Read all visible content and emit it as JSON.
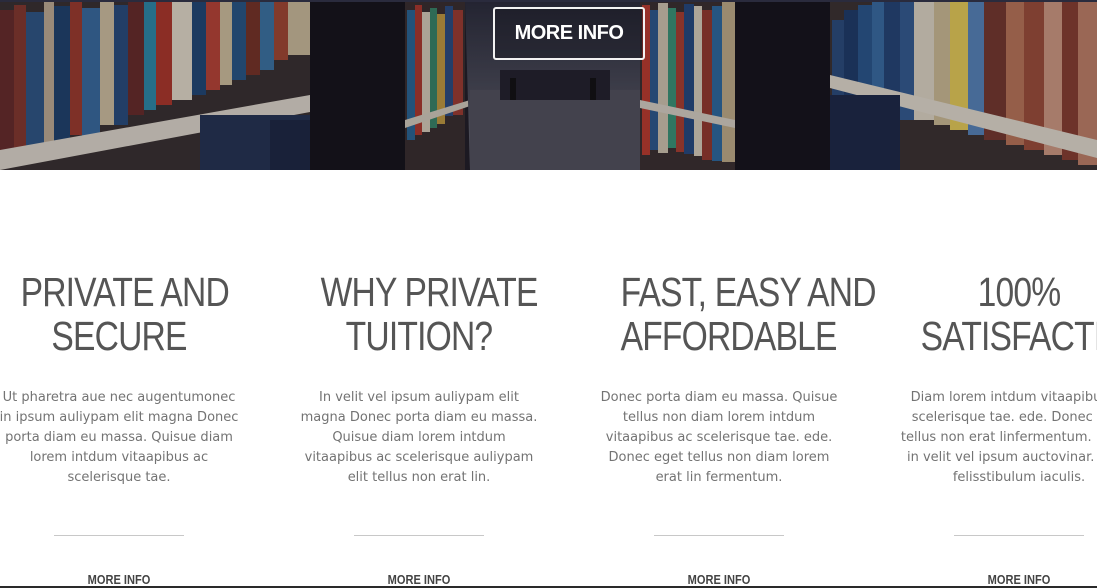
{
  "hero": {
    "button_label": "MORE INFO"
  },
  "features": [
    {
      "title_line1": "PRIVATE AND",
      "title_line2": "SECURE",
      "body": "Ut pharetra aue nec augentumonec in ipsum auliypam elit magna Donec porta diam eu massa. Quisue diam lorem intdum vitaapibus ac scelerisque tae.",
      "link": "MORE INFO"
    },
    {
      "title_line1": "WHY PRIVATE",
      "title_line2": "TUITION?",
      "body": "In velit vel ipsum auliypam elit magna Donec porta diam eu massa. Quisue diam lorem intdum vitaapibus ac scelerisque auliypam elit tellus non erat lin.",
      "link": "MORE INFO"
    },
    {
      "title_line1": "FAST, EASY AND",
      "title_line2": "AFFORDABLE",
      "body": "Donec porta diam eu massa. Quisue tellus non diam lorem intdum vitaapibus ac scelerisque tae. ede. Donec eget tellus non diam lorem erat lin fermentum.",
      "link": "MORE INFO"
    },
    {
      "title_line1": "100%",
      "title_line2": "SATISFACTION",
      "body": "Diam lorem intdum vitaapibus ac scelerisque tae. ede. Donec eget tellus non erat linfermentum. Donec in velit vel ipsum auctovinar. Proin felisstibulum iaculis.",
      "link": "MORE INFO"
    }
  ]
}
